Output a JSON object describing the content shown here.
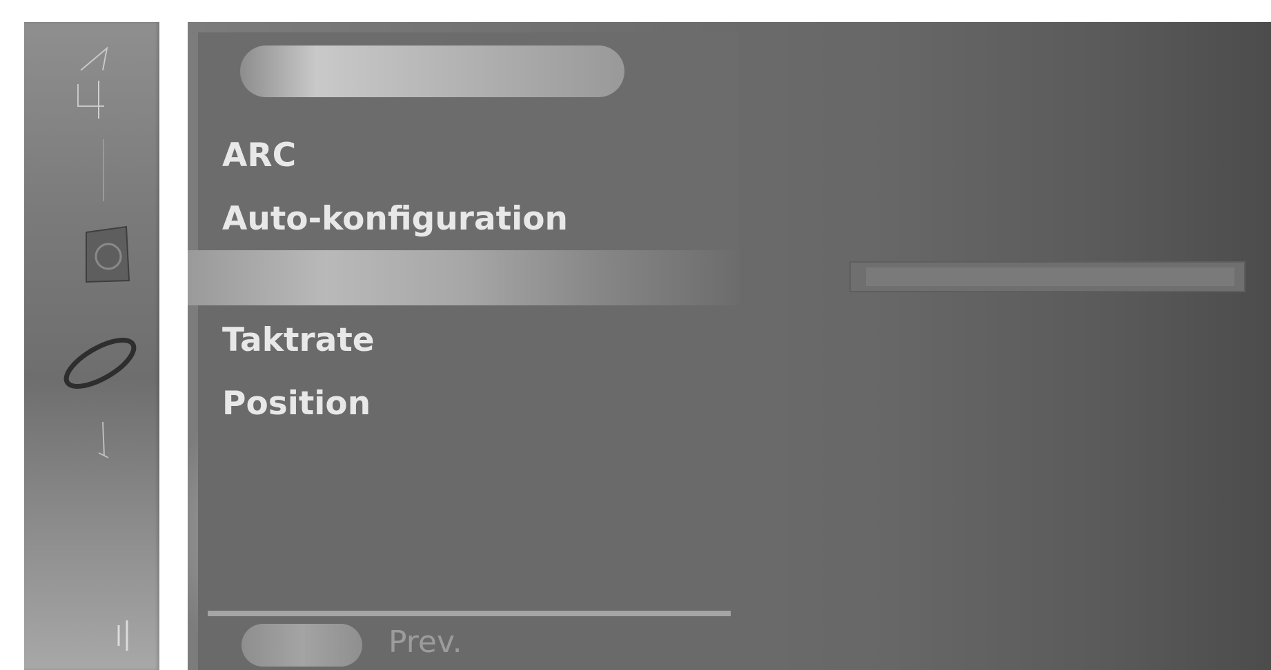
{
  "menu": {
    "items": [
      {
        "label": "ARC"
      },
      {
        "label": "Auto-konfiguration"
      },
      {
        "label": "Taktrate"
      },
      {
        "label": "Position"
      }
    ]
  },
  "footer": {
    "prev_label": "Prev."
  },
  "sidebar": {
    "icons": [
      "picture-icon",
      "sound-icon",
      "setup-icon",
      "screen-icon",
      "special-icon",
      "exit-icon"
    ]
  },
  "colors": {
    "panel": "#6c6c6c",
    "text": "#e8e8e8",
    "highlight": "#b9b9b9"
  }
}
